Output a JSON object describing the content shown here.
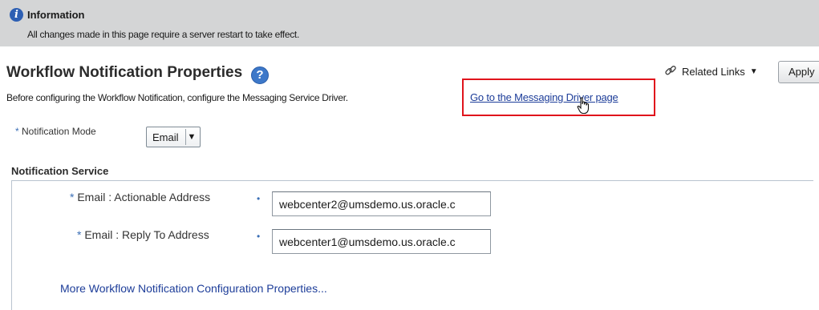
{
  "info": {
    "title": "Information",
    "message": "All changes made in this page require a server restart to take effect."
  },
  "header": {
    "title": "Workflow Notification Properties",
    "related_links": "Related Links",
    "apply": "Apply"
  },
  "config": {
    "text": "Before configuring the Workflow Notification, configure the Messaging Service Driver.",
    "link": "Go to the Messaging Driver page"
  },
  "mode": {
    "label": "Notification Mode",
    "value": "Email"
  },
  "service": {
    "title": "Notification Service",
    "fields": [
      {
        "label": "Email : Actionable Address",
        "value": "webcenter2@umsdemo.us.oracle.c"
      },
      {
        "label": "Email : Reply To Address",
        "value": "webcenter1@umsdemo.us.oracle.c"
      }
    ]
  },
  "more_link": "More Workflow Notification Configuration Properties...",
  "colors": {
    "highlight": "#e0141c",
    "link": "#1d3d99",
    "info_bar": "#d4d5d6"
  },
  "icons": [
    "info-icon",
    "help-icon",
    "link-icon",
    "chevron-down-icon",
    "hand-cursor-icon"
  ]
}
